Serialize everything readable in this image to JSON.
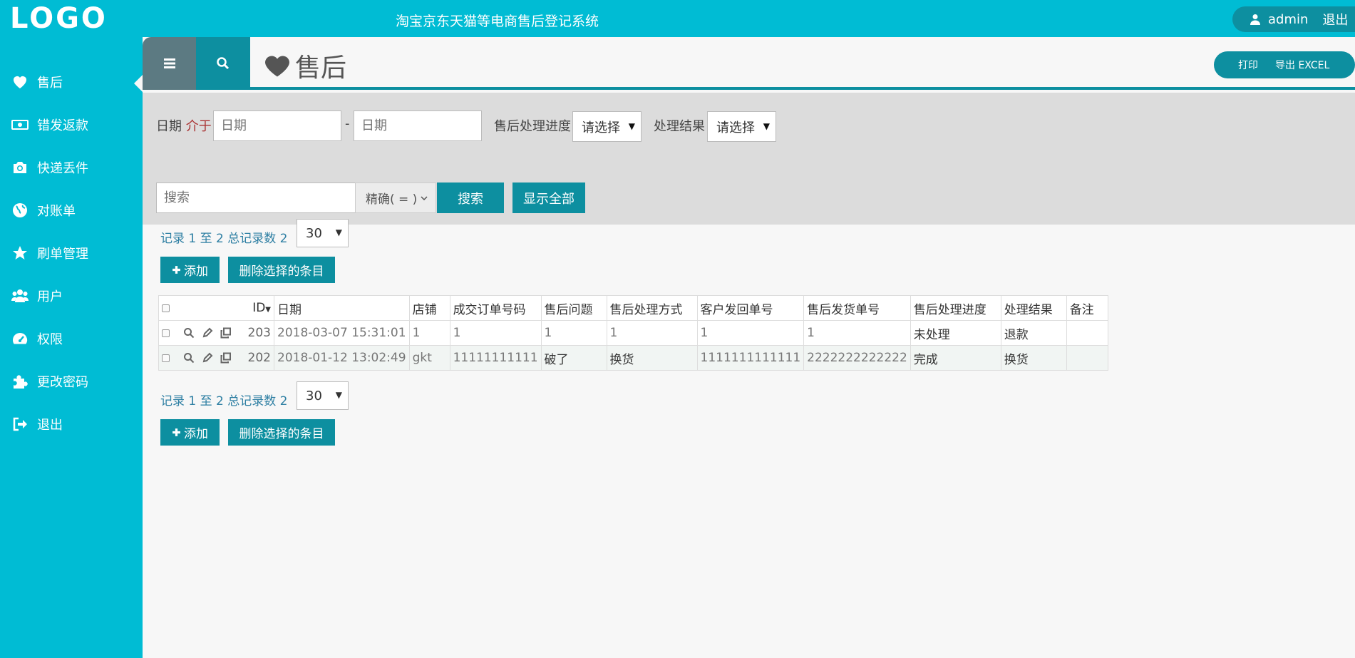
{
  "header": {
    "logo": "LOGO",
    "title": "淘宝京东天猫等电商售后登记系统",
    "user": "admin",
    "logout": "退出"
  },
  "sidebar": {
    "items": [
      {
        "label": "售后",
        "icon": "heart-icon"
      },
      {
        "label": "错发返款",
        "icon": "money-icon"
      },
      {
        "label": "快递丢件",
        "icon": "camera-icon"
      },
      {
        "label": "对账单",
        "icon": "globe-icon"
      },
      {
        "label": "刷单管理",
        "icon": "star-icon"
      },
      {
        "label": "用户",
        "icon": "users-icon"
      },
      {
        "label": "权限",
        "icon": "dashboard-icon"
      },
      {
        "label": "更改密码",
        "icon": "puzzle-icon"
      },
      {
        "label": "退出",
        "icon": "sign-out-icon"
      }
    ],
    "active_index": 0
  },
  "page": {
    "title": "售后",
    "print": "打印",
    "export": "导出 EXCEL"
  },
  "filters": {
    "date_label": "日期",
    "between_label": "介于",
    "date_from_placeholder": "日期",
    "dash": "-",
    "date_to_placeholder": "日期",
    "progress_label": "售后处理进度",
    "progress_value": "请选择",
    "result_label": "处理结果",
    "result_value": "请选择",
    "search_placeholder": "搜索",
    "match_mode": "精确( = )",
    "search_button": "搜索",
    "show_all_button": "显示全部"
  },
  "pager": {
    "records_text": "记录 1 至 2 总记录数 2",
    "page_size": "30",
    "add_button": "添加",
    "delete_selected_button": "删除选择的条目"
  },
  "table": {
    "columns": [
      "ID",
      "日期",
      "店铺",
      "成交订单号码",
      "售后问题",
      "售后处理方式",
      "客户发回单号",
      "售后发货单号",
      "售后处理进度",
      "处理结果",
      "备注"
    ],
    "rows": [
      [
        "203",
        "2018-03-07 15:31:01",
        "1",
        "1",
        "1",
        "1",
        "1",
        "1",
        "未处理",
        "退款",
        ""
      ],
      [
        "202",
        "2018-01-12 13:02:49",
        "gkt",
        "11111111111",
        "破了",
        "换货",
        "1111111111111",
        "2222222222222",
        "完成",
        "换货",
        ""
      ]
    ]
  },
  "colors": {
    "primary": "#00bcd4",
    "dark_teal": "#0d8fa0",
    "filter_bg": "#dcdcdc",
    "content_bg": "#f7f7f7"
  }
}
